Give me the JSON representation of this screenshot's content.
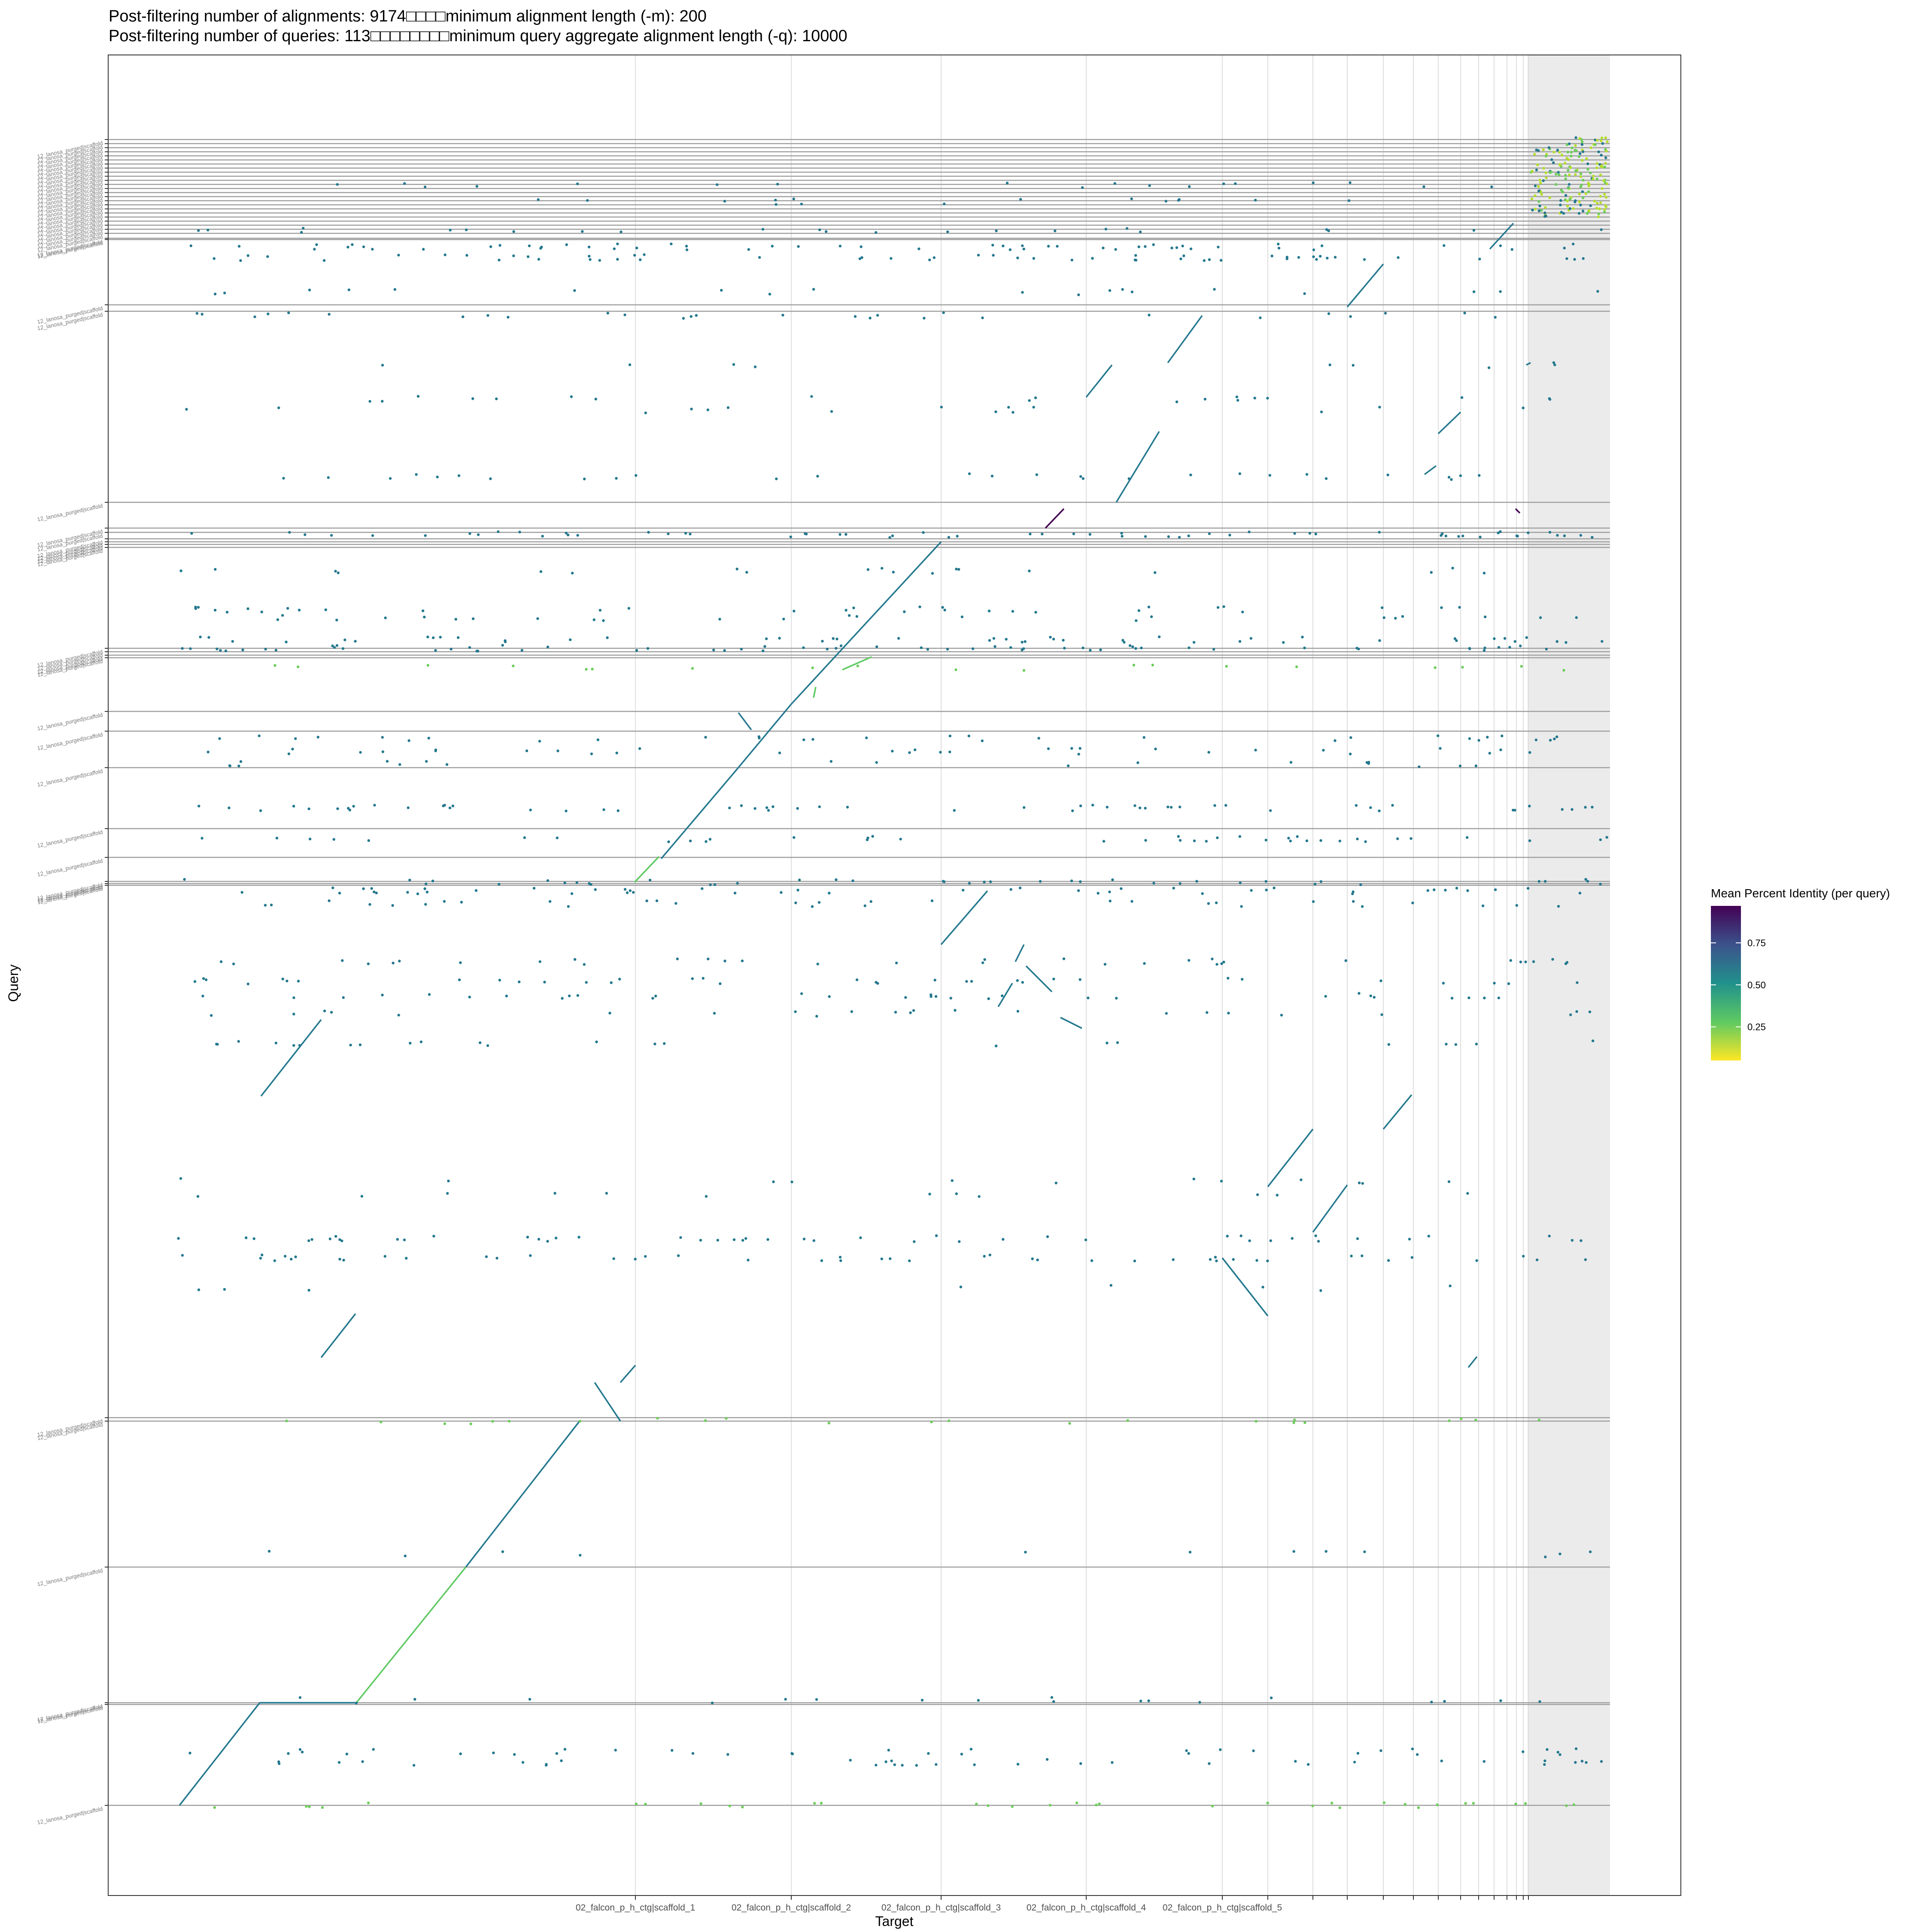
{
  "chart_data": {
    "type": "scatter",
    "title": "Post-filtering number of alignments: 9174□□□□minimum alignment length (-m): 200",
    "subtitle": "Post-filtering number of queries: 113□□□□□□□□minimum query aggregate alignment length (-q): 10000",
    "xlabel": "Target",
    "ylabel": "Query",
    "x_tick_labels": [
      "02_falcon_p_h_ctg|scaffold_1",
      "02_falcon_p_h_ctg|scaffold_2",
      "02_falcon_p_h_ctg|scaffold_3",
      "02_falcon_p_h_ctg|scaffold_4",
      "02_falcon_p_h_ctg|scaffold_5"
    ],
    "y_tick_label": "12_lanosa_purged|scaffold",
    "legend": {
      "title": "Mean Percent Identity (per query)",
      "ticks": [
        "0.75",
        "0.50",
        "0.25"
      ],
      "tick_values": [
        0.75,
        0.5,
        0.25
      ],
      "range": [
        0.05,
        0.97
      ],
      "colors": [
        "#fde725",
        "#5ec962",
        "#21918c",
        "#3b528b",
        "#440154"
      ],
      "placement": "right"
    },
    "grid": true,
    "colors": {
      "main_alignment": "#23788e",
      "high_identity": "#440154",
      "low_identity": "#6ccd5a",
      "very_low_identity": "#c2df23"
    }
  }
}
